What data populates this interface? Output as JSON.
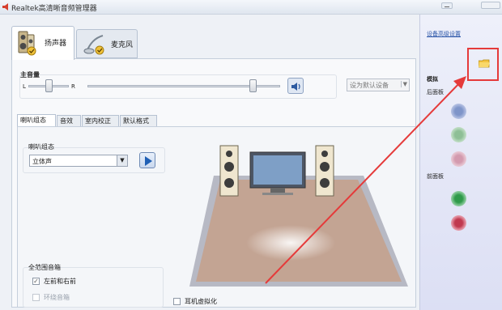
{
  "window": {
    "title": "Realtek高清晰音频管理器"
  },
  "device_tabs": [
    {
      "label": "扬声器",
      "icon": "speaker-icon",
      "active": true
    },
    {
      "label": "麦克风",
      "icon": "microphone-icon",
      "active": false
    }
  ],
  "volume": {
    "label": "主音量",
    "left": "L",
    "right": "R",
    "balance": 0.5,
    "level": 0.84
  },
  "default_device": {
    "label": "设为默认设备"
  },
  "sub_tabs": [
    "喇叭组态",
    "音效",
    "室内校正",
    "默认格式"
  ],
  "speaker_config": {
    "label": "喇叭组态",
    "selected": "立体声"
  },
  "full_range": {
    "label": "全范围音箱",
    "front_lr": {
      "label": "左前和右前",
      "checked": true
    },
    "surround": {
      "label": "环绕音箱",
      "checked": false,
      "disabled": true
    }
  },
  "headphone_virtualization": {
    "label": "耳机虚拟化",
    "checked": false
  },
  "right_panel": {
    "advanced_link": "设备高级设置",
    "analog_label": "模拟",
    "rear_label": "后面板",
    "front_label": "前面板",
    "jack_colors": [
      "#7f95c9",
      "#8ebf96",
      "#d39aae",
      "#2f9a4a",
      "#c0394f"
    ]
  },
  "colors": {
    "highlight": "#e53a3a",
    "link": "#2a55a8"
  }
}
